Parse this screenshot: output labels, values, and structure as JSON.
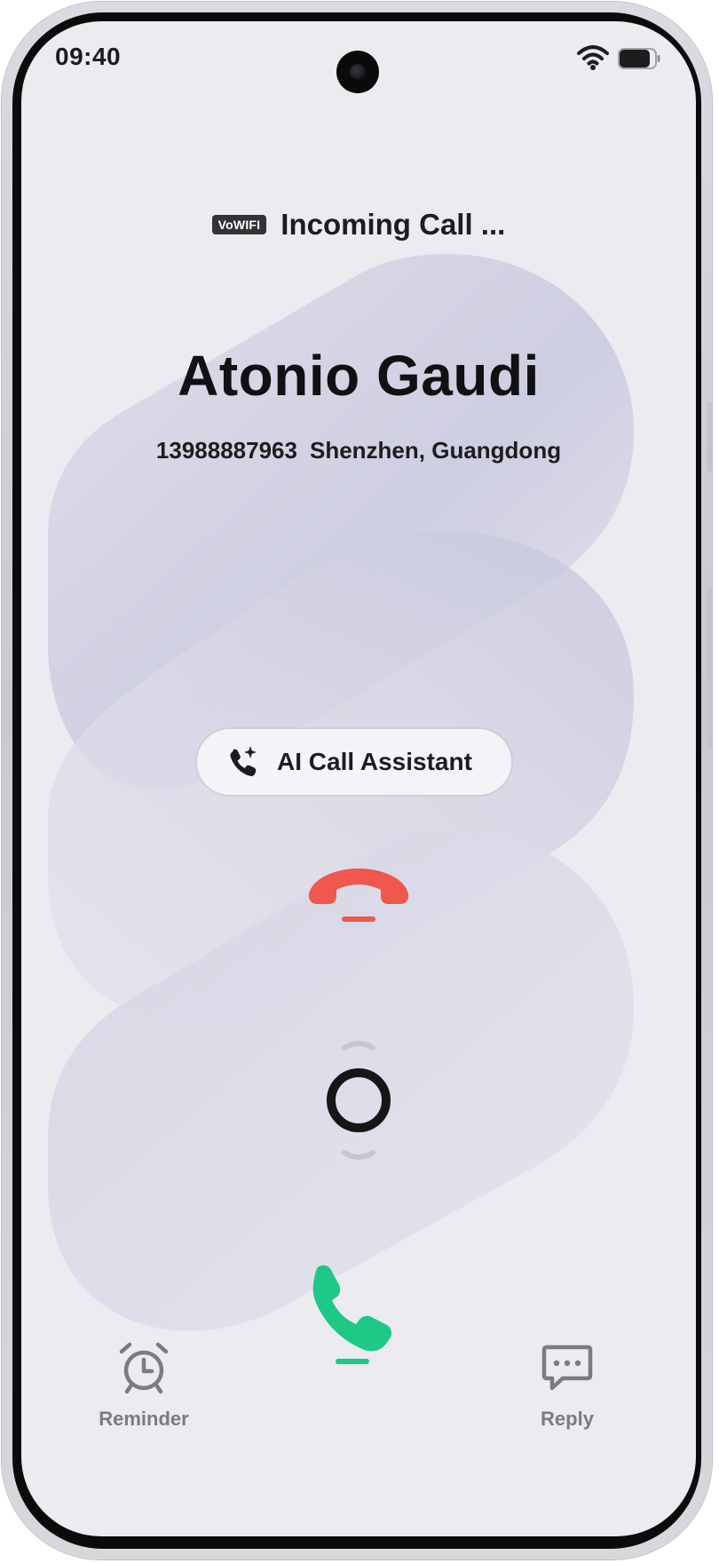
{
  "status_bar": {
    "time": "09:40",
    "icons": [
      "wifi-icon",
      "battery-icon"
    ]
  },
  "call": {
    "network_badge": "VoWIFI",
    "status": "Incoming Call ...",
    "caller_name": "Atonio Gaudi",
    "phone_number": "13988887963",
    "location": "Shenzhen, Guangdong"
  },
  "ai_assistant": {
    "label": "AI Call Assistant",
    "icon": "ai-phone-sparkle-icon"
  },
  "controls": {
    "decline_icon": "decline-call-icon",
    "slider_icon": "slider-handle-icon",
    "answer_icon": "answer-call-icon"
  },
  "bottom_actions": {
    "reminder": {
      "label": "Reminder",
      "icon": "alarm-clock-icon"
    },
    "reply": {
      "label": "Reply",
      "icon": "message-bubble-icon"
    }
  },
  "colors": {
    "screen_bg": "#ebebf0",
    "decline": "#f0574d",
    "answer": "#1fc887",
    "ribbon": "#c8c8de",
    "muted_text": "#7b7b80"
  }
}
